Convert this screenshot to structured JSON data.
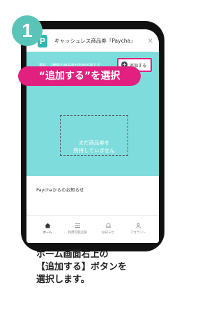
{
  "step": {
    "number": "1",
    "color": "#5bc4b9"
  },
  "app": {
    "logo": "P",
    "title": "キャッシュレス商品券「Paycha」",
    "close_glyph": "×"
  },
  "main": {
    "status_text": "現在、1種類の商品券が利用可能です",
    "add_button_label": "追加する",
    "callout_text": "“追加する”を選択",
    "empty_line1": "まだ商品券を",
    "empty_line2": "所持していません",
    "notice_header": "Paychaからのお知らせ",
    "accent_color": "#e2207f",
    "teal_color": "#7fdcdc"
  },
  "tabs": [
    {
      "label": "ホーム",
      "icon": "home-icon"
    },
    {
      "label": "利用可能店舗",
      "icon": "list-icon"
    },
    {
      "label": "お知らせ",
      "icon": "bell-icon"
    },
    {
      "label": "アカウント",
      "icon": "person-icon"
    }
  ],
  "caption": {
    "line1": "ホーム画面右上の",
    "line2": "【追加する】ボタンを",
    "line3": "選択します。"
  }
}
